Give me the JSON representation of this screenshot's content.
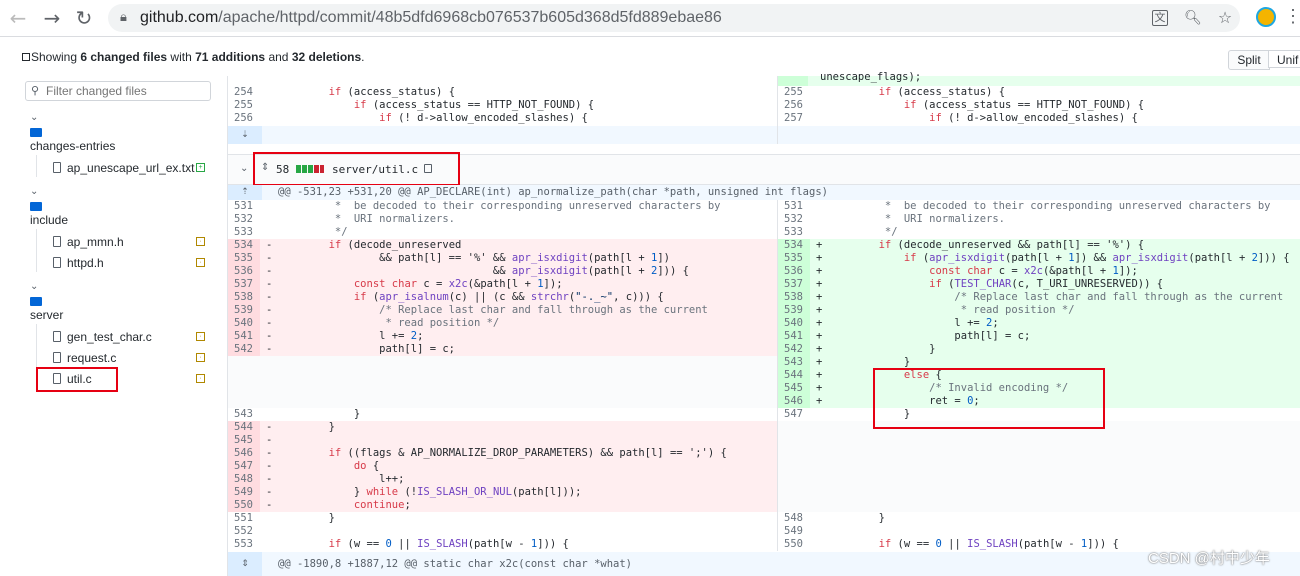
{
  "browser": {
    "url_host": "github.com",
    "url_path": "/apache/httpd/commit/48b5dfd6968cb076537b605d368d5fd889ebae86"
  },
  "summary": {
    "prefix": "Showing ",
    "changed": "6 changed files",
    "mid": " with ",
    "additions": "71 additions",
    "and": " and ",
    "deletions": "32 deletions",
    "end": "."
  },
  "view": {
    "split": "Split",
    "unified": "Unif"
  },
  "sidebar": {
    "filter_placeholder": "Filter changed files",
    "dirs": [
      {
        "name": "changes-entries",
        "files": [
          {
            "name": "ap_unescape_url_ex.txt",
            "status": "added"
          }
        ]
      },
      {
        "name": "include",
        "files": [
          {
            "name": "ap_mmn.h",
            "status": "modified"
          },
          {
            "name": "httpd.h",
            "status": "modified"
          }
        ]
      },
      {
        "name": "server",
        "files": [
          {
            "name": "gen_test_char.c",
            "status": "modified"
          },
          {
            "name": "request.c",
            "status": "modified"
          },
          {
            "name": "util.c",
            "status": "modified"
          }
        ]
      }
    ]
  },
  "top_fragment": {
    "right_overflow": "unescape_flags);",
    "rows": [
      {
        "l": "254",
        "r": "255",
        "code": "        if (access_status) {"
      },
      {
        "l": "255",
        "r": "256",
        "code": "            if (access_status == HTTP_NOT_FOUND) {"
      },
      {
        "l": "256",
        "r": "257",
        "code": "                if (! d->allow_encoded_slashes) {"
      }
    ]
  },
  "file_header": {
    "changes": "58",
    "path": "server/util.c"
  },
  "hunk1": "@@ -531,23 +531,20 @@ AP_DECLARE(int) ap_normalize_path(char *path, unsigned int flags)",
  "hunk2": "@@ -1890,8 +1887,12 @@ static char x2c(const char *what)",
  "left_rows": [
    {
      "ln": "531",
      "mk": "",
      "code": "         *  be decoded to their corresponding unreserved characters by"
    },
    {
      "ln": "532",
      "mk": "",
      "code": "         *  URI normalizers."
    },
    {
      "ln": "533",
      "mk": "",
      "code": "         */"
    },
    {
      "ln": "534",
      "mk": "-",
      "code": "        if (decode_unreserved"
    },
    {
      "ln": "535",
      "mk": "-",
      "code": "                && path[l] == '%' && apr_isxdigit(path[l + 1])"
    },
    {
      "ln": "536",
      "mk": "-",
      "code": "                                  && apr_isxdigit(path[l + 2])) {"
    },
    {
      "ln": "537",
      "mk": "-",
      "code": "            const char c = x2c(&path[l + 1]);"
    },
    {
      "ln": "538",
      "mk": "-",
      "code": "            if (apr_isalnum(c) || (c && strchr(\"-._~\", c))) {"
    },
    {
      "ln": "539",
      "mk": "-",
      "code": "                /* Replace last char and fall through as the current"
    },
    {
      "ln": "540",
      "mk": "-",
      "code": "                 * read position */"
    },
    {
      "ln": "541",
      "mk": "-",
      "code": "                l += 2;"
    },
    {
      "ln": "542",
      "mk": "-",
      "code": "                path[l] = c;"
    },
    {
      "ln": "",
      "mk": "",
      "code": ""
    },
    {
      "ln": "",
      "mk": "",
      "code": ""
    },
    {
      "ln": "",
      "mk": "",
      "code": ""
    },
    {
      "ln": "",
      "mk": "",
      "code": ""
    },
    {
      "ln": "543",
      "mk": "",
      "code": "            }"
    },
    {
      "ln": "544",
      "mk": "-",
      "code": "        }"
    },
    {
      "ln": "545",
      "mk": "-",
      "code": ""
    },
    {
      "ln": "546",
      "mk": "-",
      "code": "        if ((flags & AP_NORMALIZE_DROP_PARAMETERS) && path[l] == ';') {"
    },
    {
      "ln": "547",
      "mk": "-",
      "code": "            do {"
    },
    {
      "ln": "548",
      "mk": "-",
      "code": "                l++;"
    },
    {
      "ln": "549",
      "mk": "-",
      "code": "            } while (!IS_SLASH_OR_NUL(path[l]));"
    },
    {
      "ln": "550",
      "mk": "-",
      "code": "            continue;"
    },
    {
      "ln": "551",
      "mk": "",
      "code": "        }"
    },
    {
      "ln": "552",
      "mk": "",
      "code": ""
    },
    {
      "ln": "553",
      "mk": "",
      "code": "        if (w == 0 || IS_SLASH(path[w - 1])) {"
    }
  ],
  "right_rows": [
    {
      "ln": "531",
      "mk": "",
      "code": "         *  be decoded to their corresponding unreserved characters by"
    },
    {
      "ln": "532",
      "mk": "",
      "code": "         *  URI normalizers."
    },
    {
      "ln": "533",
      "mk": "",
      "code": "         */"
    },
    {
      "ln": "534",
      "mk": "+",
      "code": "        if (decode_unreserved && path[l] == '%') {"
    },
    {
      "ln": "535",
      "mk": "+",
      "code": "            if (apr_isxdigit(path[l + 1]) && apr_isxdigit(path[l + 2])) {"
    },
    {
      "ln": "536",
      "mk": "+",
      "code": "                const char c = x2c(&path[l + 1]);"
    },
    {
      "ln": "537",
      "mk": "+",
      "code": "                if (TEST_CHAR(c, T_URI_UNRESERVED)) {"
    },
    {
      "ln": "538",
      "mk": "+",
      "code": "                    /* Replace last char and fall through as the current"
    },
    {
      "ln": "539",
      "mk": "+",
      "code": "                     * read position */"
    },
    {
      "ln": "540",
      "mk": "+",
      "code": "                    l += 2;"
    },
    {
      "ln": "541",
      "mk": "+",
      "code": "                    path[l] = c;"
    },
    {
      "ln": "542",
      "mk": "+",
      "code": "                }"
    },
    {
      "ln": "543",
      "mk": "+",
      "code": "            }"
    },
    {
      "ln": "544",
      "mk": "+",
      "code": "            else {"
    },
    {
      "ln": "545",
      "mk": "+",
      "code": "                /* Invalid encoding */"
    },
    {
      "ln": "546",
      "mk": "+",
      "code": "                ret = 0;"
    },
    {
      "ln": "547",
      "mk": "",
      "code": "            }"
    },
    {
      "ln": "",
      "mk": "",
      "code": ""
    },
    {
      "ln": "",
      "mk": "",
      "code": ""
    },
    {
      "ln": "",
      "mk": "",
      "code": ""
    },
    {
      "ln": "",
      "mk": "",
      "code": ""
    },
    {
      "ln": "",
      "mk": "",
      "code": ""
    },
    {
      "ln": "",
      "mk": "",
      "code": ""
    },
    {
      "ln": "",
      "mk": "",
      "code": ""
    },
    {
      "ln": "548",
      "mk": "",
      "code": "        }"
    },
    {
      "ln": "549",
      "mk": "",
      "code": ""
    },
    {
      "ln": "550",
      "mk": "",
      "code": "        if (w == 0 || IS_SLASH(path[w - 1])) {"
    }
  ],
  "watermark": "CSDN @村中少年",
  "colors": {
    "del_bg": "#ffeef0",
    "del_num_bg": "#ffdce0",
    "add_bg": "#e6ffed",
    "add_num_bg": "#cdffd8",
    "empty_bg": "#fafbfc",
    "hunk_bg": "#f1f8ff",
    "expand_bg": "#dbedff",
    "highlight_box": "#e60012"
  },
  "icons": {
    "back": "arrow-left-icon",
    "forward": "arrow-right-icon",
    "reload": "reload-icon",
    "lock": "lock-icon",
    "translate": "translate-icon",
    "zoom": "zoom-icon",
    "star": "star-icon"
  }
}
